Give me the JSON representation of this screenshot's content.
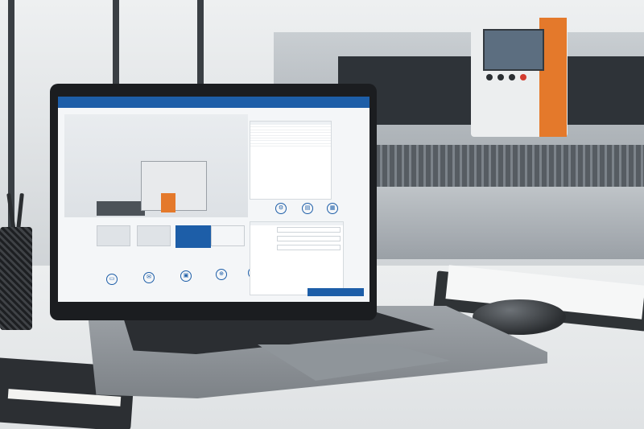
{
  "scene": {
    "description_kind": "photo",
    "colors": {
      "brand_blue": "#1d5ea8",
      "machine_orange": "#e4792b",
      "laptop_body": "#8f959a"
    }
  },
  "laptop_ui": {
    "spec_panel": {
      "title": "",
      "rows": [
        {
          "label": "",
          "value": ""
        },
        {
          "label": "",
          "value": ""
        },
        {
          "label": "",
          "value": ""
        },
        {
          "label": "",
          "value": ""
        },
        {
          "label": "",
          "value": ""
        },
        {
          "label": "",
          "value": ""
        },
        {
          "label": "",
          "value": ""
        },
        {
          "label": "",
          "value": ""
        }
      ],
      "icons": [
        "gear-icon",
        "document-icon",
        "chart-icon"
      ]
    },
    "feature_icons": [
      "laptop-icon",
      "mail-icon",
      "settings-icon",
      "network-icon",
      "info-icon"
    ],
    "form": {
      "title": "",
      "fields": [
        "",
        "",
        ""
      ],
      "submit_label": ""
    }
  }
}
